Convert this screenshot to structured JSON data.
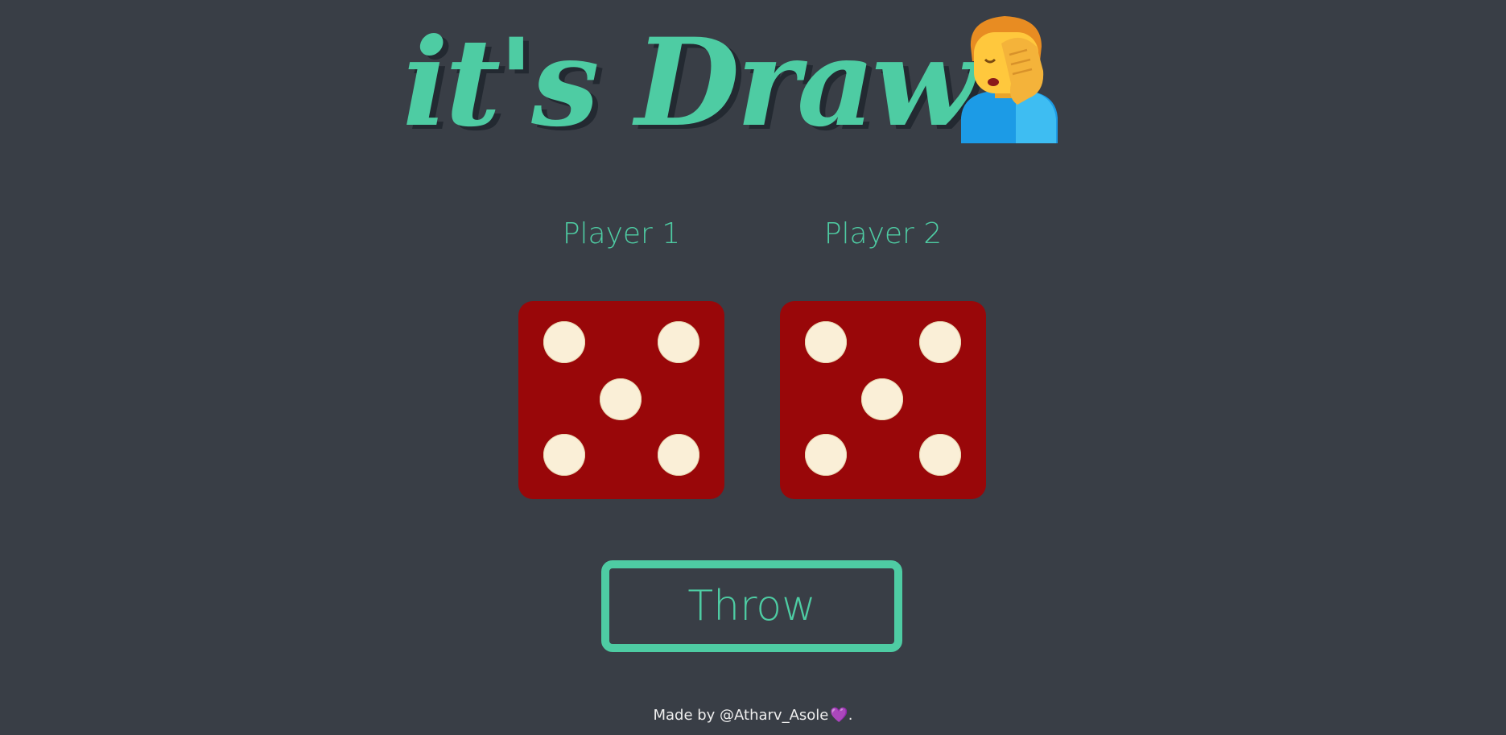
{
  "title": "it's Draw!",
  "title_emoji": "man-facepalming-icon",
  "players": [
    {
      "label": "Player 1",
      "die_value": 5
    },
    {
      "label": "Player 2",
      "die_value": 5
    }
  ],
  "throw_button": {
    "label": "Throw"
  },
  "footer": {
    "prefix": "Made by @Atharv_Asole",
    "heart": "💜",
    "suffix": "."
  },
  "colors": {
    "background": "#393e46",
    "accent": "#4ecca3",
    "die": "#990709",
    "pip": "#faefd7",
    "heart": "#9b6bd6"
  }
}
